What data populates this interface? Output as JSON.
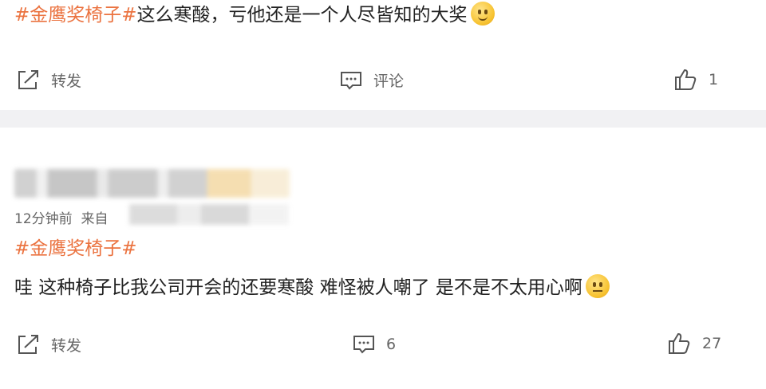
{
  "post1": {
    "hashtag": "#金鹰奖椅子#",
    "text": "这么寒酸，亏他还是一个人尽皆知的大奖",
    "emoji": "smiley-emoji",
    "repost_label": "转发",
    "comment_label": "评论",
    "like_count": "1"
  },
  "post2": {
    "time": "12分钟前",
    "source_prefix": "来自",
    "hashtag": "#金鹰奖椅子#",
    "text": "哇 这种椅子比我公司开会的还要寒酸 难怪被人嘲了 是不是不太用心啊",
    "emoji": "thinking-emoji",
    "repost_label": "转发",
    "comment_count": "6",
    "like_count": "27"
  },
  "icons": {
    "repost": "share-icon",
    "comment": "comment-icon",
    "like": "thumbs-up-icon"
  },
  "colors": {
    "hashtag": "#eb7340",
    "action_text": "#666666",
    "separator": "#f1f1f3"
  }
}
